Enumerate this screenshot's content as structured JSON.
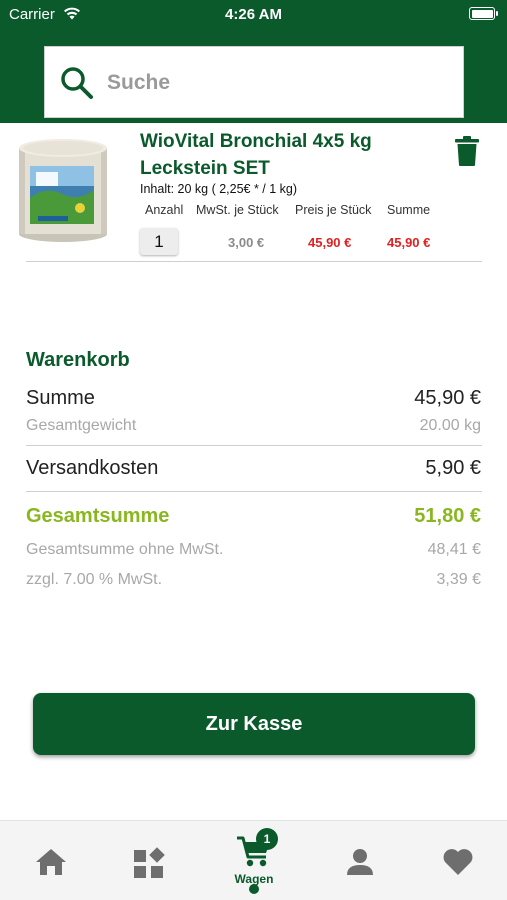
{
  "status_bar": {
    "carrier": "Carrier",
    "time": "4:26 AM"
  },
  "search": {
    "placeholder": "Suche",
    "value": ""
  },
  "cart_item": {
    "title_line1": "WioVital Bronchial  4x5 kg",
    "title_line2": "Leckstein SET",
    "content": "Inhalt: 20 kg ( 2,25€ * / 1 kg)",
    "columns": [
      "Anzahl",
      "MwSt. je Stück",
      "Preis je Stück",
      "Summe"
    ],
    "quantity": "1",
    "vat_per_item": "3,00 €",
    "price_per_item": "45,90 €",
    "sum": "45,90 €",
    "image_icon": "product-package"
  },
  "summary": {
    "title": "Warenkorb",
    "rows": [
      {
        "label": "Summe",
        "value": "45,90 €"
      },
      {
        "label": "Gesamtgewicht",
        "value": "20.00 kg"
      },
      {
        "label": "Versandkosten",
        "value": "5,90 €"
      },
      {
        "label": "Gesamtsumme",
        "value": "51,80 €"
      },
      {
        "label": "Gesamtsumme ohne MwSt.",
        "value": "48,41 €"
      },
      {
        "label": "zzgl. 7.00 % MwSt.",
        "value": "3,39 €"
      }
    ]
  },
  "checkout": {
    "label": "Zur Kasse"
  },
  "tabbar": {
    "items": [
      {
        "name": "home",
        "icon": "home-icon",
        "label": ""
      },
      {
        "name": "categories",
        "icon": "categories-icon",
        "label": ""
      },
      {
        "name": "cart",
        "icon": "cart-icon",
        "label": "Wagen",
        "badge": "1",
        "active": true
      },
      {
        "name": "account",
        "icon": "person-icon",
        "label": ""
      },
      {
        "name": "wishlist",
        "icon": "heart-icon",
        "label": ""
      }
    ]
  },
  "colors": {
    "brand_green": "#0b5a2c",
    "accent_lime": "#8ab71f",
    "price_red": "#e02020",
    "muted_grey": "#a8a8a8"
  }
}
